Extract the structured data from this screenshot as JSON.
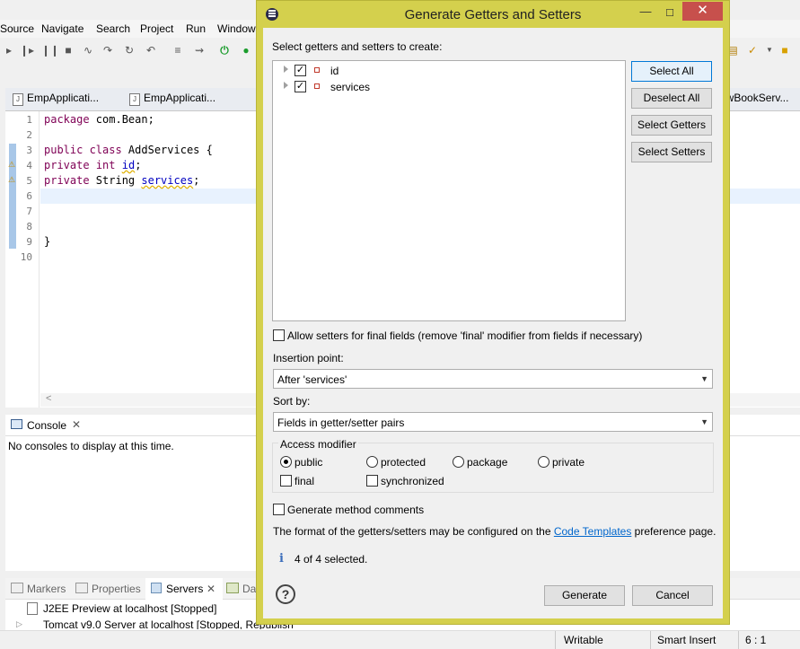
{
  "menu": [
    "Source",
    "Navigate",
    "Search",
    "Project",
    "Run",
    "Window"
  ],
  "editor_tabs": [
    "EmpApplicati...",
    "EmpApplicati...",
    "owBookServ..."
  ],
  "code_lines": [
    {
      "n": "1",
      "text": "package com.Bean;"
    },
    {
      "n": "2",
      "text": ""
    },
    {
      "n": "3",
      "text": "public class AddServices {"
    },
    {
      "n": "4",
      "text": "private int id;"
    },
    {
      "n": "5",
      "text": "private String services;"
    },
    {
      "n": "6",
      "text": ""
    },
    {
      "n": "7",
      "text": ""
    },
    {
      "n": "8",
      "text": ""
    },
    {
      "n": "9",
      "text": "}"
    },
    {
      "n": "10",
      "text": ""
    }
  ],
  "code": {
    "l1_kw": "package",
    "l1_rest": " com.Bean;",
    "l3_kw": "public class",
    "l3_rest": " AddServices {",
    "l4_kw1": "private",
    "l4_kw2": "int",
    "l4_field": "id",
    "l5_kw": "private",
    "l5_type": " String ",
    "l5_field": "services",
    "l9": "}"
  },
  "console": {
    "tab_label": "Console",
    "message": "No consoles to display at this time."
  },
  "bottom_tabs": [
    "Markers",
    "Properties",
    "Servers",
    "Da"
  ],
  "servers": [
    "J2EE Preview at localhost  [Stopped]",
    "Tomcat v9.0 Server at localhost  [Stopped, Republish"
  ],
  "status_bar": {
    "mode": "Writable",
    "insert": "Smart Insert",
    "position": "6 : 1"
  },
  "dialog": {
    "title": "Generate Getters and Setters",
    "select_label": "Select getters and setters to create:",
    "tree_items": [
      {
        "label": "id",
        "checked": true
      },
      {
        "label": "services",
        "checked": true
      }
    ],
    "buttons": {
      "select_all": "Select All",
      "deselect_all": "Deselect All",
      "select_getters": "Select Getters",
      "select_setters": "Select Setters",
      "generate": "Generate",
      "cancel": "Cancel"
    },
    "allow_setters_final": "Allow setters for final fields (remove 'final' modifier from fields if necessary)",
    "insertion_point_label": "Insertion point:",
    "insertion_point_value": "After 'services'",
    "sort_by_label": "Sort by:",
    "sort_by_value": "Fields in getter/setter pairs",
    "access_modifier_label": "Access modifier",
    "access_options": [
      "public",
      "protected",
      "package",
      "private"
    ],
    "access_selected": "public",
    "final_label": "final",
    "synchronized_label": "synchronized",
    "generate_comments": "Generate method comments",
    "format_text_before": "The format of the getters/setters may be configured on the ",
    "format_link": "Code Templates",
    "format_text_after": " preference page.",
    "selection_status": "4 of 4 selected."
  },
  "icons": {
    "dialog_system": "menu-icon",
    "info": "info-icon",
    "help": "help-icon",
    "field": "field-icon"
  },
  "colors": {
    "dialog_frame": "#d4d04d",
    "close_button": "#c7504c",
    "keyword": "#7f0055",
    "field": "#0000c0",
    "link": "#0066cc"
  }
}
